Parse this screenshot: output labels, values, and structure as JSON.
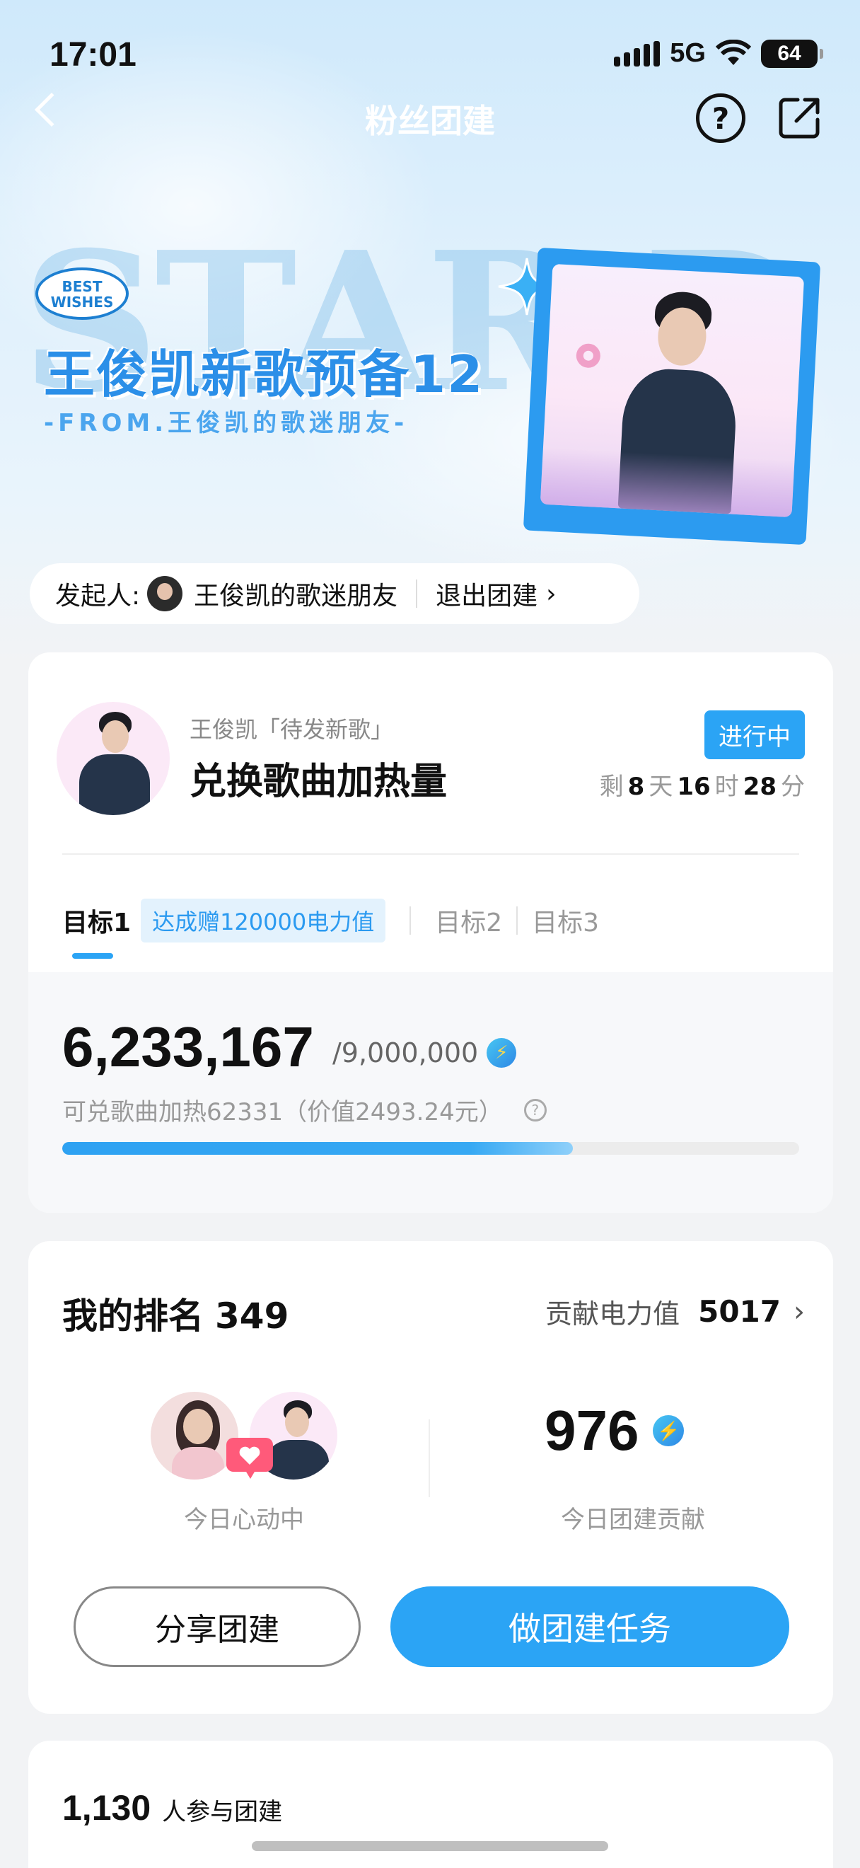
{
  "status_bar": {
    "time": "17:01",
    "network": "5G",
    "battery": "64"
  },
  "nav": {
    "title": "粉丝团建",
    "help": "?"
  },
  "hero": {
    "badge_line1": "BEST",
    "badge_line2": "WISHES",
    "bg_text": "STAR D",
    "title": "王俊凯新歌预备12",
    "subtitle": "-FROM.王俊凯的歌迷朋友-"
  },
  "initiator": {
    "label": "发起人:",
    "name": "王俊凯的歌迷朋友",
    "exit": "退出团建"
  },
  "song": {
    "artist": "王俊凯「待发新歌」",
    "title": "兑换歌曲加热量",
    "status": "进行中",
    "remaining": {
      "prefix": "剩",
      "days": "8",
      "day_unit": "天",
      "hours": "16",
      "hour_unit": "时",
      "minutes": "28",
      "minute_unit": "分"
    }
  },
  "tabs": {
    "goal1": "目标1",
    "goal1_badge": "达成赠120000电力值",
    "goal2": "目标2",
    "goal3": "目标3"
  },
  "goal": {
    "current": "6,233,167",
    "total": "/9,000,000",
    "description": "可兑歌曲加热62331（价值2493.24元）",
    "progress": 0.6926
  },
  "rank": {
    "label": "我的排名",
    "value": "349",
    "contribution_label": "贡献电力值",
    "contribution_value": "5017",
    "pair_label": "今日心动中",
    "today_value": "976",
    "today_label": "今日团建贡献"
  },
  "buttons": {
    "share": "分享团建",
    "task": "做团建任务"
  },
  "participants": {
    "count": "1,130",
    "label": "人参与团建"
  },
  "colors": {
    "accent": "#2ba4f5",
    "hero_title": "#2b8fe8"
  }
}
